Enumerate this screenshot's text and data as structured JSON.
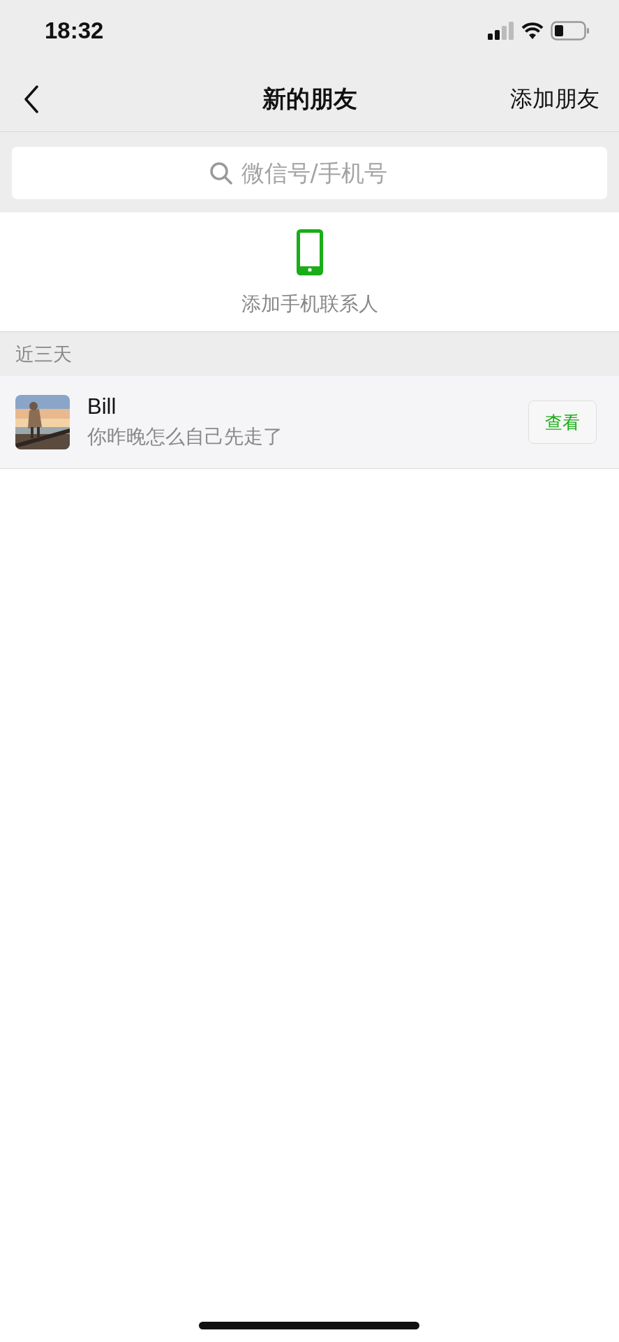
{
  "status_bar": {
    "time": "18:32"
  },
  "nav": {
    "title": "新的朋友",
    "action": "添加朋友"
  },
  "search": {
    "placeholder": "微信号/手机号"
  },
  "add_contacts": {
    "label": "添加手机联系人"
  },
  "section": {
    "title": "近三天"
  },
  "requests": [
    {
      "name": "Bill",
      "message": "你昨晚怎么自己先走了",
      "action": "查看"
    }
  ]
}
